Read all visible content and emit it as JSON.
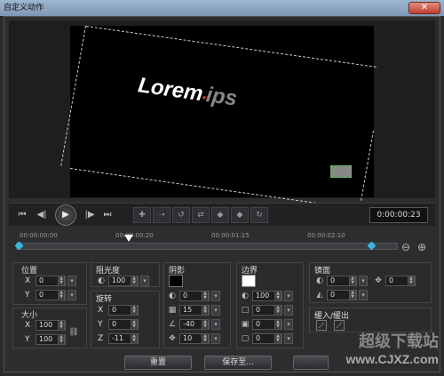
{
  "window": {
    "title": "自定义动作",
    "close": "✕"
  },
  "preview": {
    "text_main": "Lorem",
    "text_dot": "•",
    "text_tail": "ips"
  },
  "transport": {
    "buttons": [
      "⏮",
      "◀|",
      "▶",
      "|▶",
      "⏭"
    ],
    "timecode": "0:00:00:23"
  },
  "timeline": {
    "ticks": [
      "00:00:00:00",
      "00:00:00:20",
      "00:00:01:15",
      "00:00:02:10"
    ],
    "playhead_position": 0.3
  },
  "panels": {
    "position": {
      "title": "位置",
      "x_label": "X",
      "x": "0",
      "y_label": "Y",
      "y": "0"
    },
    "size": {
      "title": "大小",
      "x_label": "X",
      "x": "100",
      "y_label": "Y",
      "y": "100"
    },
    "opacity": {
      "title": "阻光度",
      "value": "100"
    },
    "rotation": {
      "title": "旋转",
      "x_label": "X",
      "x": "0",
      "y_label": "Y",
      "y": "0",
      "z_label": "Z",
      "z": "-11"
    },
    "shadow": {
      "title": "阴影",
      "color": "#000000",
      "v1": "0",
      "v2": "15",
      "v3": "-40",
      "v4": "10"
    },
    "border": {
      "title": "边界",
      "color": "#ffffff",
      "v1": "100",
      "v2": "0",
      "v3": "0",
      "v4": "0"
    },
    "mirror": {
      "title": "镜面",
      "v1": "0",
      "v2": "0",
      "v3": "0"
    },
    "fade": {
      "title": "缓入/缓出"
    }
  },
  "footer": {
    "reset": "重置",
    "save": "保存至..."
  },
  "watermark": {
    "line1": "超级下载站",
    "line2": "www.CJXZ.com"
  }
}
